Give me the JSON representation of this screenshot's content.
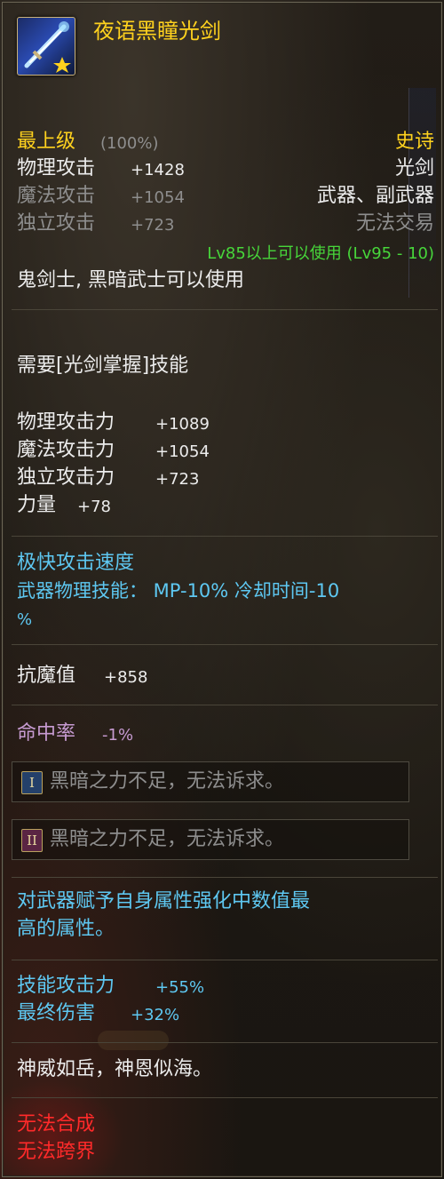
{
  "item": {
    "name": "夜语黑瞳光剑",
    "icon": "sword-icon",
    "grade": "最上级",
    "grade_percent": "(100%)",
    "rarity": "史诗",
    "weapon_type": "光剑",
    "slot": "武器、副武器",
    "trade": "无法交易",
    "base_stats": [
      {
        "label": "物理攻击",
        "value": "+1428"
      },
      {
        "label": "魔法攻击",
        "value": "+1054"
      },
      {
        "label": "独立攻击",
        "value": "+723"
      }
    ],
    "level_req": "Lv85以上可以使用 (Lv95 - 10)",
    "class_req": "鬼剑士, 黑暗武士可以使用",
    "skill_req": "需要[光剑掌握]技能",
    "stats": [
      {
        "label": "物理攻击力",
        "value": "+1089"
      },
      {
        "label": "魔法攻击力",
        "value": "+1054"
      },
      {
        "label": "独立攻击力",
        "value": "+723"
      },
      {
        "label": "力量",
        "value": "+78"
      }
    ],
    "speed": "极快攻击速度",
    "weapon_skill_line1": "武器物理技能： MP-10% 冷却时间-10",
    "weapon_skill_line2": "%",
    "anti_magic": {
      "label": "抗魔值",
      "value": "+858"
    },
    "hit_rate": {
      "label": "命中率",
      "value": "-1%"
    },
    "runes": [
      {
        "badge": "I",
        "text": "黑暗之力不足，无法诉求。"
      },
      {
        "badge": "II",
        "text": "黑暗之力不足，无法诉求。"
      }
    ],
    "element_line1": "对武器赋予自身属性强化中数值最",
    "element_line2": "高的属性。",
    "bonus": [
      {
        "label": "技能攻击力",
        "value": "+55%"
      },
      {
        "label": "最终伤害",
        "value": "+32%"
      }
    ],
    "flavor": "神威如岳，神恩似海。",
    "restrictions": [
      "无法合成",
      "无法跨界"
    ]
  },
  "colors": {
    "gold": "#ffd21e",
    "green": "#47d63a",
    "blue": "#5ec8f2",
    "purple": "#c79bd2",
    "red": "#ff2a2a",
    "gray": "#8e8e8e"
  }
}
